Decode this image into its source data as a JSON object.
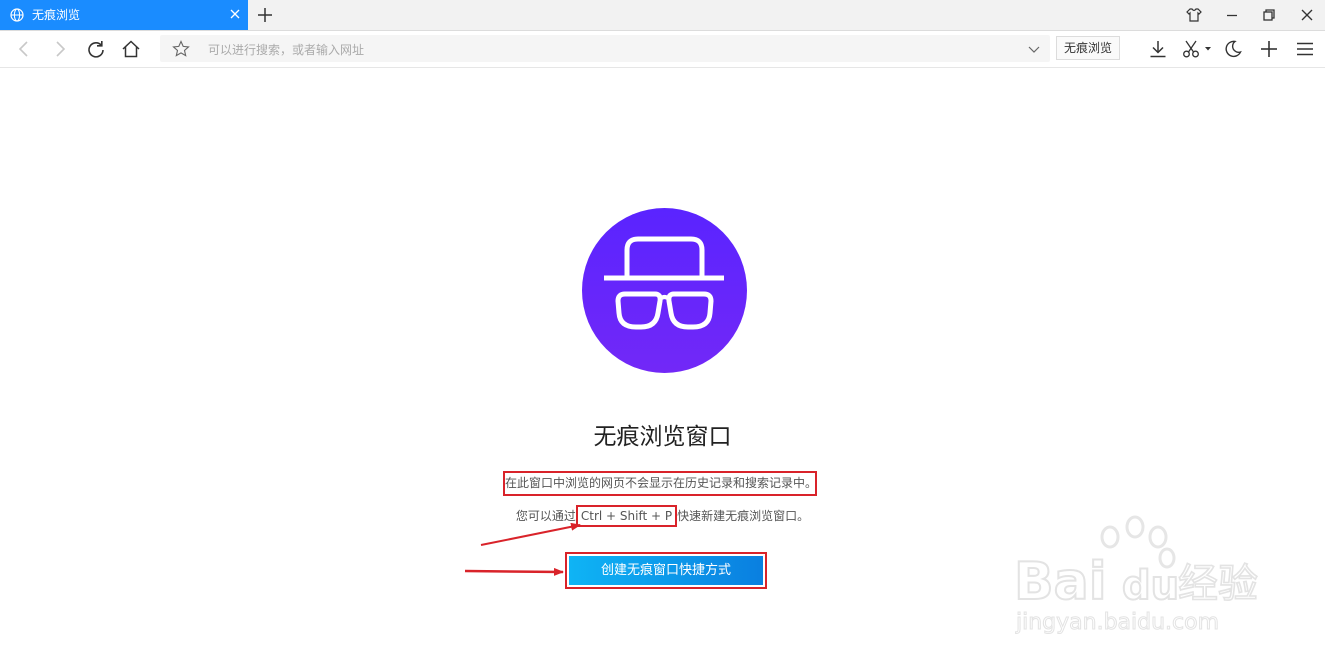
{
  "tab": {
    "title": "无痕浏览",
    "icon": "globe-icon"
  },
  "address_bar": {
    "placeholder": "可以进行搜索，或者输入网址",
    "value": ""
  },
  "toolbar": {
    "incognito_label": "无痕浏览"
  },
  "content": {
    "heading": "无痕浏览窗口",
    "description": "在此窗口中浏览的网页不会显示在历史记录和搜索记录中。",
    "shortcut_prefix": "您可以通过",
    "shortcut_keys": "Ctrl + Shift + P",
    "shortcut_suffix": "快速新建无痕浏览窗口。",
    "create_button": "创建无痕窗口快捷方式"
  },
  "watermark": {
    "brand_left": "Bai",
    "brand_right": "du",
    "brand_cn": "经验",
    "url": "jingyan.baidu.com"
  },
  "colors": {
    "tab_active": "#1a8cff",
    "incognito_avatar": "#6228fa",
    "create_button": "#0a7fe0",
    "annotation_red": "#d9232a"
  }
}
